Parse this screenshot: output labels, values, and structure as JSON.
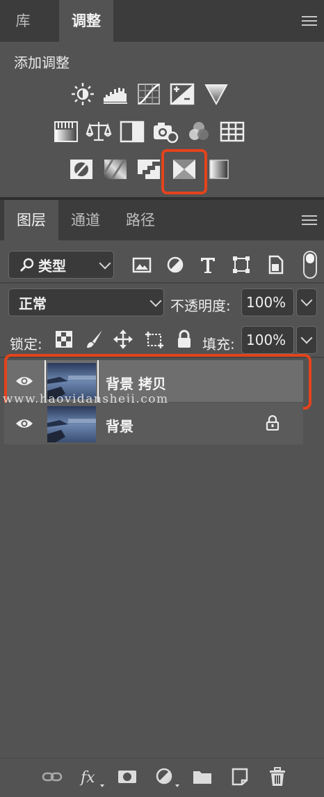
{
  "top_panel": {
    "tabs": [
      {
        "label": "库"
      },
      {
        "label": "调整"
      }
    ],
    "add_adjustment_title": "添加调整"
  },
  "layers_panel": {
    "tabs": [
      {
        "label": "图层"
      },
      {
        "label": "通道"
      },
      {
        "label": "路径"
      }
    ],
    "filter_kind": "类型",
    "blend_mode": "正常",
    "opacity_label": "不透明度:",
    "opacity_value": "100%",
    "lock_label": "锁定:",
    "fill_label": "填充:",
    "fill_value": "100%",
    "layers": [
      {
        "name": "背景 拷贝",
        "selected": true,
        "locked": false
      },
      {
        "name": "背景",
        "selected": false,
        "locked": true
      }
    ]
  },
  "watermark": "www.haoyidansheji.com",
  "colors": {
    "panel_bg": "#535353",
    "tabbar_bg": "#3c3c3c",
    "highlight": "#e4431c",
    "selected_row": "#6e6e6e"
  }
}
